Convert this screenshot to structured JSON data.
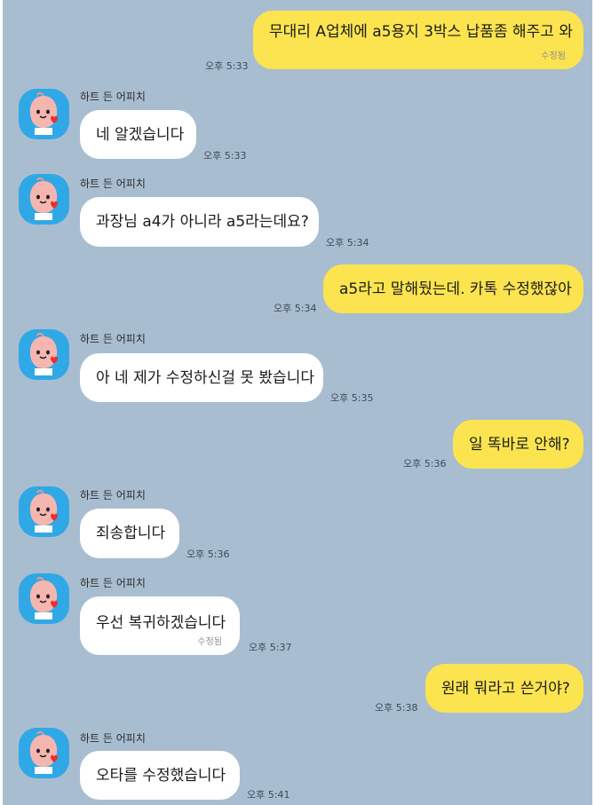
{
  "chat": {
    "sender_name": "하트 든 어피치",
    "edited_label": "수정됨",
    "messages": [
      {
        "from": "me",
        "text": "무대리 A업체에 a5용지 3박스 납품좀 해주고 와",
        "time": "오후 5:33",
        "edited": true
      },
      {
        "from": "them",
        "text": "네 알겠습니다",
        "time": "오후 5:33",
        "edited": false
      },
      {
        "from": "them",
        "text": "과장님 a4가 아니라 a5라는데요?",
        "time": "오후 5:34",
        "edited": false
      },
      {
        "from": "me",
        "text": "a5라고 말해뒀는데. 카톡 수정했잖아",
        "time": "오후 5:34",
        "edited": false
      },
      {
        "from": "them",
        "text": "아 네 제가 수정하신걸 못 봤습니다",
        "time": "오후 5:35",
        "edited": false
      },
      {
        "from": "me",
        "text": "일 똑바로 안해?",
        "time": "오후 5:36",
        "edited": false
      },
      {
        "from": "them",
        "text": "죄송합니다",
        "time": "오후 5:36",
        "edited": false
      },
      {
        "from": "them",
        "text": "우선 복귀하겠습니다",
        "time": "오후 5:37",
        "edited": true
      },
      {
        "from": "me",
        "text": "원래 뭐라고 쓴거야?",
        "time": "오후 5:38",
        "edited": false
      },
      {
        "from": "them",
        "text": "오타를 수정했습니다",
        "time": "오후 5:41",
        "edited": false
      }
    ]
  },
  "colors": {
    "background": "#a9bdd1",
    "my_bubble": "#fbe44f",
    "their_bubble": "#ffffff",
    "avatar_bg": "#30a8e6"
  },
  "icons": {
    "avatar": "apeach-heart-icon"
  }
}
